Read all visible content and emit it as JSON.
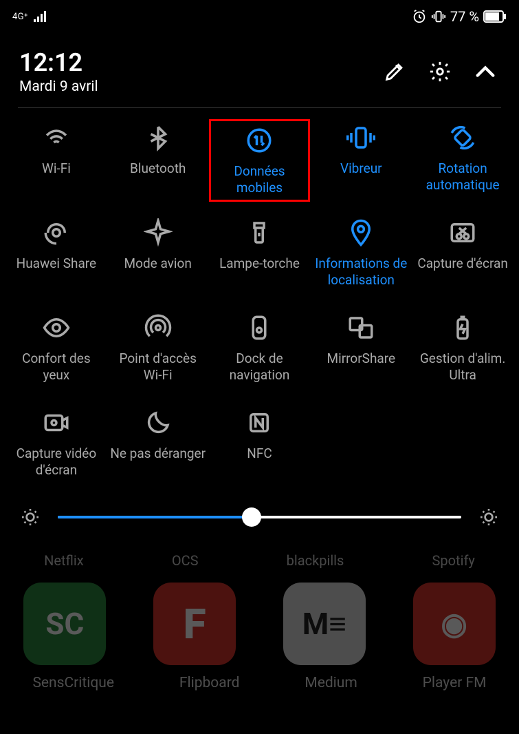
{
  "status": {
    "network": "4G⁺",
    "alarm": "⏰",
    "vibrate": "📳",
    "battery_pct": "77 %",
    "battery_icon": "🔋"
  },
  "header": {
    "time": "12:12",
    "date": "Mardi 9 avril"
  },
  "tiles": [
    {
      "id": "wifi",
      "label": "Wi-Fi",
      "active": false,
      "icon": "wifi"
    },
    {
      "id": "bluetooth",
      "label": "Bluetooth",
      "active": false,
      "icon": "bluetooth"
    },
    {
      "id": "mobile-data",
      "label": "Données mobiles",
      "active": true,
      "icon": "data",
      "highlight": true
    },
    {
      "id": "vibrate",
      "label": "Vibreur",
      "active": true,
      "icon": "vibrate"
    },
    {
      "id": "autorotate",
      "label": "Rotation automatique",
      "active": true,
      "icon": "rotate"
    },
    {
      "id": "huawei-share",
      "label": "Huawei Share",
      "active": false,
      "icon": "share"
    },
    {
      "id": "airplane",
      "label": "Mode avion",
      "active": false,
      "icon": "airplane"
    },
    {
      "id": "flashlight",
      "label": "Lampe-torche",
      "active": false,
      "icon": "torch"
    },
    {
      "id": "location",
      "label": "Informations de localisation",
      "active": true,
      "icon": "location"
    },
    {
      "id": "screenshot",
      "label": "Capture d'écran",
      "active": false,
      "icon": "scissors"
    },
    {
      "id": "eye-comfort",
      "label": "Confort des yeux",
      "active": false,
      "icon": "eye"
    },
    {
      "id": "hotspot",
      "label": "Point d'accès Wi-Fi",
      "active": false,
      "icon": "hotspot"
    },
    {
      "id": "nav-dock",
      "label": "Dock de navigation",
      "active": false,
      "icon": "dock"
    },
    {
      "id": "mirrorshare",
      "label": "MirrorShare",
      "active": false,
      "icon": "mirror"
    },
    {
      "id": "power-mgmt",
      "label": "Gestion d'alim. Ultra",
      "active": false,
      "icon": "battery"
    },
    {
      "id": "screen-record",
      "label": "Capture vidéo d'écran",
      "active": false,
      "icon": "record"
    },
    {
      "id": "dnd",
      "label": "Ne pas déranger",
      "active": false,
      "icon": "moon"
    },
    {
      "id": "nfc",
      "label": "NFC",
      "active": false,
      "icon": "nfc"
    }
  ],
  "brightness": {
    "percent": 48
  },
  "bg_apps_top": [
    "Netflix",
    "OCS",
    "blackpills",
    "Spotify"
  ],
  "bg_apps_bottom": [
    "SensCritique",
    "Flipboard",
    "Medium",
    "Player FM"
  ]
}
